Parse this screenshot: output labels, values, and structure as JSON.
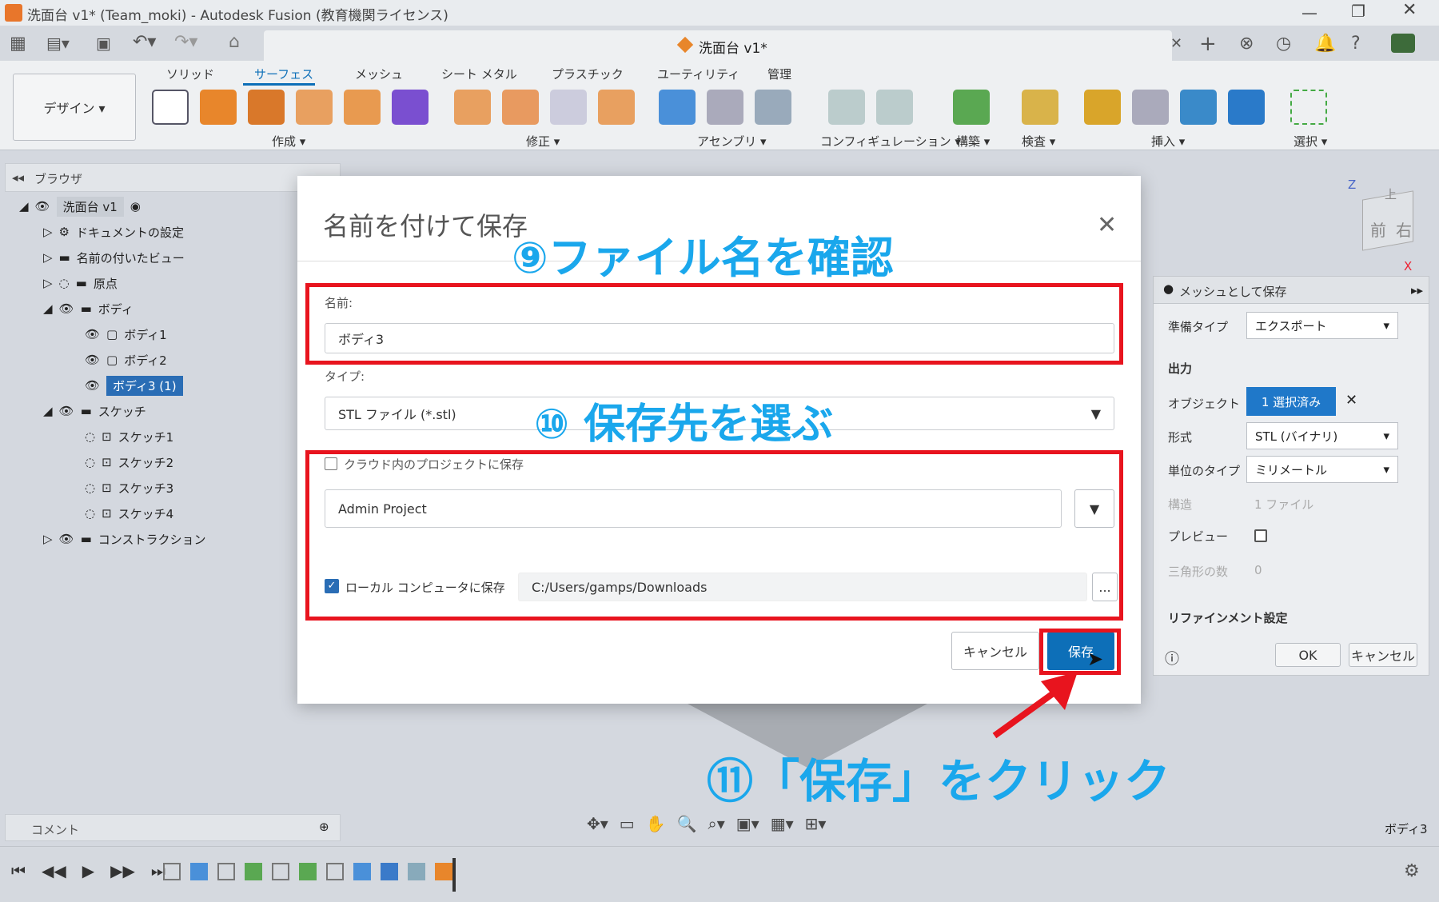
{
  "app": {
    "window_title": "洗面台 v1* (Team_moki) - Autodesk Fusion (教育機関ライセンス)",
    "doc_tab": "洗面台 v1*"
  },
  "ribbon": {
    "workspace": "デザイン ▾",
    "tabs": [
      "ソリッド",
      "サーフェス",
      "メッシュ",
      "シート メタル",
      "プラスチック",
      "ユーティリティ",
      "管理"
    ],
    "groups": [
      "作成 ▾",
      "修正 ▾",
      "アセンブリ ▾",
      "コンフィギュレーション ▾",
      "構築 ▾",
      "検査 ▾",
      "挿入 ▾",
      "選択 ▾"
    ]
  },
  "browser": {
    "header": "ブラウザ",
    "root": "洗面台 v1",
    "items": [
      "ドキュメントの設定",
      "名前の付いたビュー",
      "原点",
      "ボディ",
      "ボディ1",
      "ボディ2",
      "ボディ3 (1)",
      "スケッチ",
      "スケッチ1",
      "スケッチ2",
      "スケッチ3",
      "スケッチ4",
      "コンストラクション"
    ]
  },
  "viewcube": {
    "top": "上",
    "front": "前",
    "right": "右",
    "x": "X",
    "z": "Z"
  },
  "dialog": {
    "title": "名前を付けて保存",
    "name_label": "名前:",
    "name_value": "ボディ3",
    "type_label": "タイプ:",
    "type_value": "STL ファイル (*.stl)",
    "cloud_label": "クラウド内のプロジェクトに保存",
    "project_value": "Admin Project",
    "local_label": "ローカル コンピュータに保存",
    "local_path": "C:/Users/gamps/Downloads",
    "browse": "...",
    "cancel": "キャンセル",
    "save": "保存"
  },
  "callouts": {
    "step9": "⑨ファイル名を確認",
    "step10": "⑩ 保存先を選ぶ",
    "step11": "⑪「保存」をクリック"
  },
  "mesh_panel": {
    "title": "メッシュとして保存",
    "prep_label": "準備タイプ",
    "prep_value": "エクスポート",
    "output": "出力",
    "object_label": "オブジェクト",
    "object_value": "1 選択済み",
    "format_label": "形式",
    "format_value": "STL (バイナリ)",
    "unit_label": "単位のタイプ",
    "unit_value": "ミリメートル",
    "struct_label": "構造",
    "struct_value": "1 ファイル",
    "preview_label": "プレビュー",
    "tri_label": "三角形の数",
    "tri_value": "0",
    "refine": "リファインメント設定",
    "ok": "OK",
    "cancel": "キャンセル"
  },
  "status": {
    "comment": "コメント",
    "selection": "ボディ3"
  },
  "colors": {
    "red": "#e8141e",
    "callout": "#1aa7ec",
    "primary": "#0d6fb8"
  }
}
